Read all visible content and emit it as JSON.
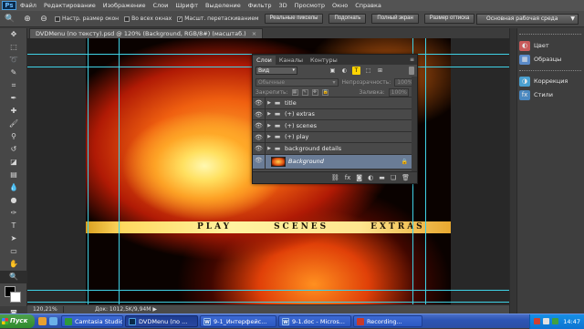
{
  "app": {
    "logo": "Ps"
  },
  "menu": [
    "Файл",
    "Редактирование",
    "Изображение",
    "Слои",
    "Шрифт",
    "Выделение",
    "Фильтр",
    "3D",
    "Просмотр",
    "Окно",
    "Справка"
  ],
  "options": {
    "tool_icon": "zoom-icon",
    "checkbox_resize": {
      "label": "Настр. размер окон",
      "checked": false
    },
    "checkbox_all_windows": {
      "label": "Во всех окнах",
      "checked": false
    },
    "checkbox_scrubby": {
      "label": "Масшт. перетаскиванием",
      "checked": true
    },
    "btn_actual_pixels": "Реальные пикселы",
    "btn_fit_screen": "Подогнать",
    "btn_fill_screen": "Полный экран",
    "btn_print_size": "Размер оттиска",
    "workspace": "Основная рабочая среда"
  },
  "document": {
    "tab_title": "DVDMenu (по тексту).psd @ 120% (Background, RGB/8#) (масштаб.)",
    "close": "×",
    "menu_labels": [
      "PLAY",
      "SCENES",
      "EXTRAS"
    ]
  },
  "status": {
    "zoom": "120,21%",
    "doc_info": "Док: 1012,5K/9,94M",
    "arrow": "▶"
  },
  "dock": {
    "items": [
      {
        "label": "Цвет",
        "icon": "color-icon",
        "color": "#c85a5a"
      },
      {
        "label": "Образцы",
        "icon": "swatches-icon",
        "color": "#5a8ac8"
      },
      {
        "label": "Коррекция",
        "icon": "adjustments-icon",
        "color": "#4aa0d0"
      },
      {
        "label": "Стили",
        "icon": "styles-icon",
        "color": "#4a88c0"
      }
    ]
  },
  "layers_panel": {
    "tabs": [
      "Слои",
      "Каналы",
      "Контуры"
    ],
    "kind": "Вид",
    "blend_mode": "Обычные",
    "opacity_label": "Непрозрачность:",
    "opacity_value": "100%",
    "lock_label": "Закрепить:",
    "fill_label": "Заливка:",
    "fill_value": "100%",
    "layers": [
      {
        "name": "title",
        "type": "group"
      },
      {
        "name": "(+) extras",
        "type": "group"
      },
      {
        "name": "(+) scenes",
        "type": "group"
      },
      {
        "name": "(+) play",
        "type": "group"
      },
      {
        "name": "background details",
        "type": "group"
      },
      {
        "name": "Background",
        "type": "background",
        "locked": true
      }
    ]
  },
  "taskbar": {
    "start": "Пуск",
    "tasks": [
      {
        "label": "Camtasia Studio...",
        "color": "#2e9a3a",
        "active": false
      },
      {
        "label": "DVDMenu (по ...",
        "color": "#0b2a4a",
        "active": true
      },
      {
        "label": "9-1_Интерфейс...",
        "color": "#2a5fb8",
        "active": false
      },
      {
        "label": "9-1.doc - Micros...",
        "color": "#2a5fb8",
        "active": false
      },
      {
        "label": "Recording...",
        "color": "#c83a2a",
        "active": false
      }
    ],
    "clock": "14:47"
  }
}
